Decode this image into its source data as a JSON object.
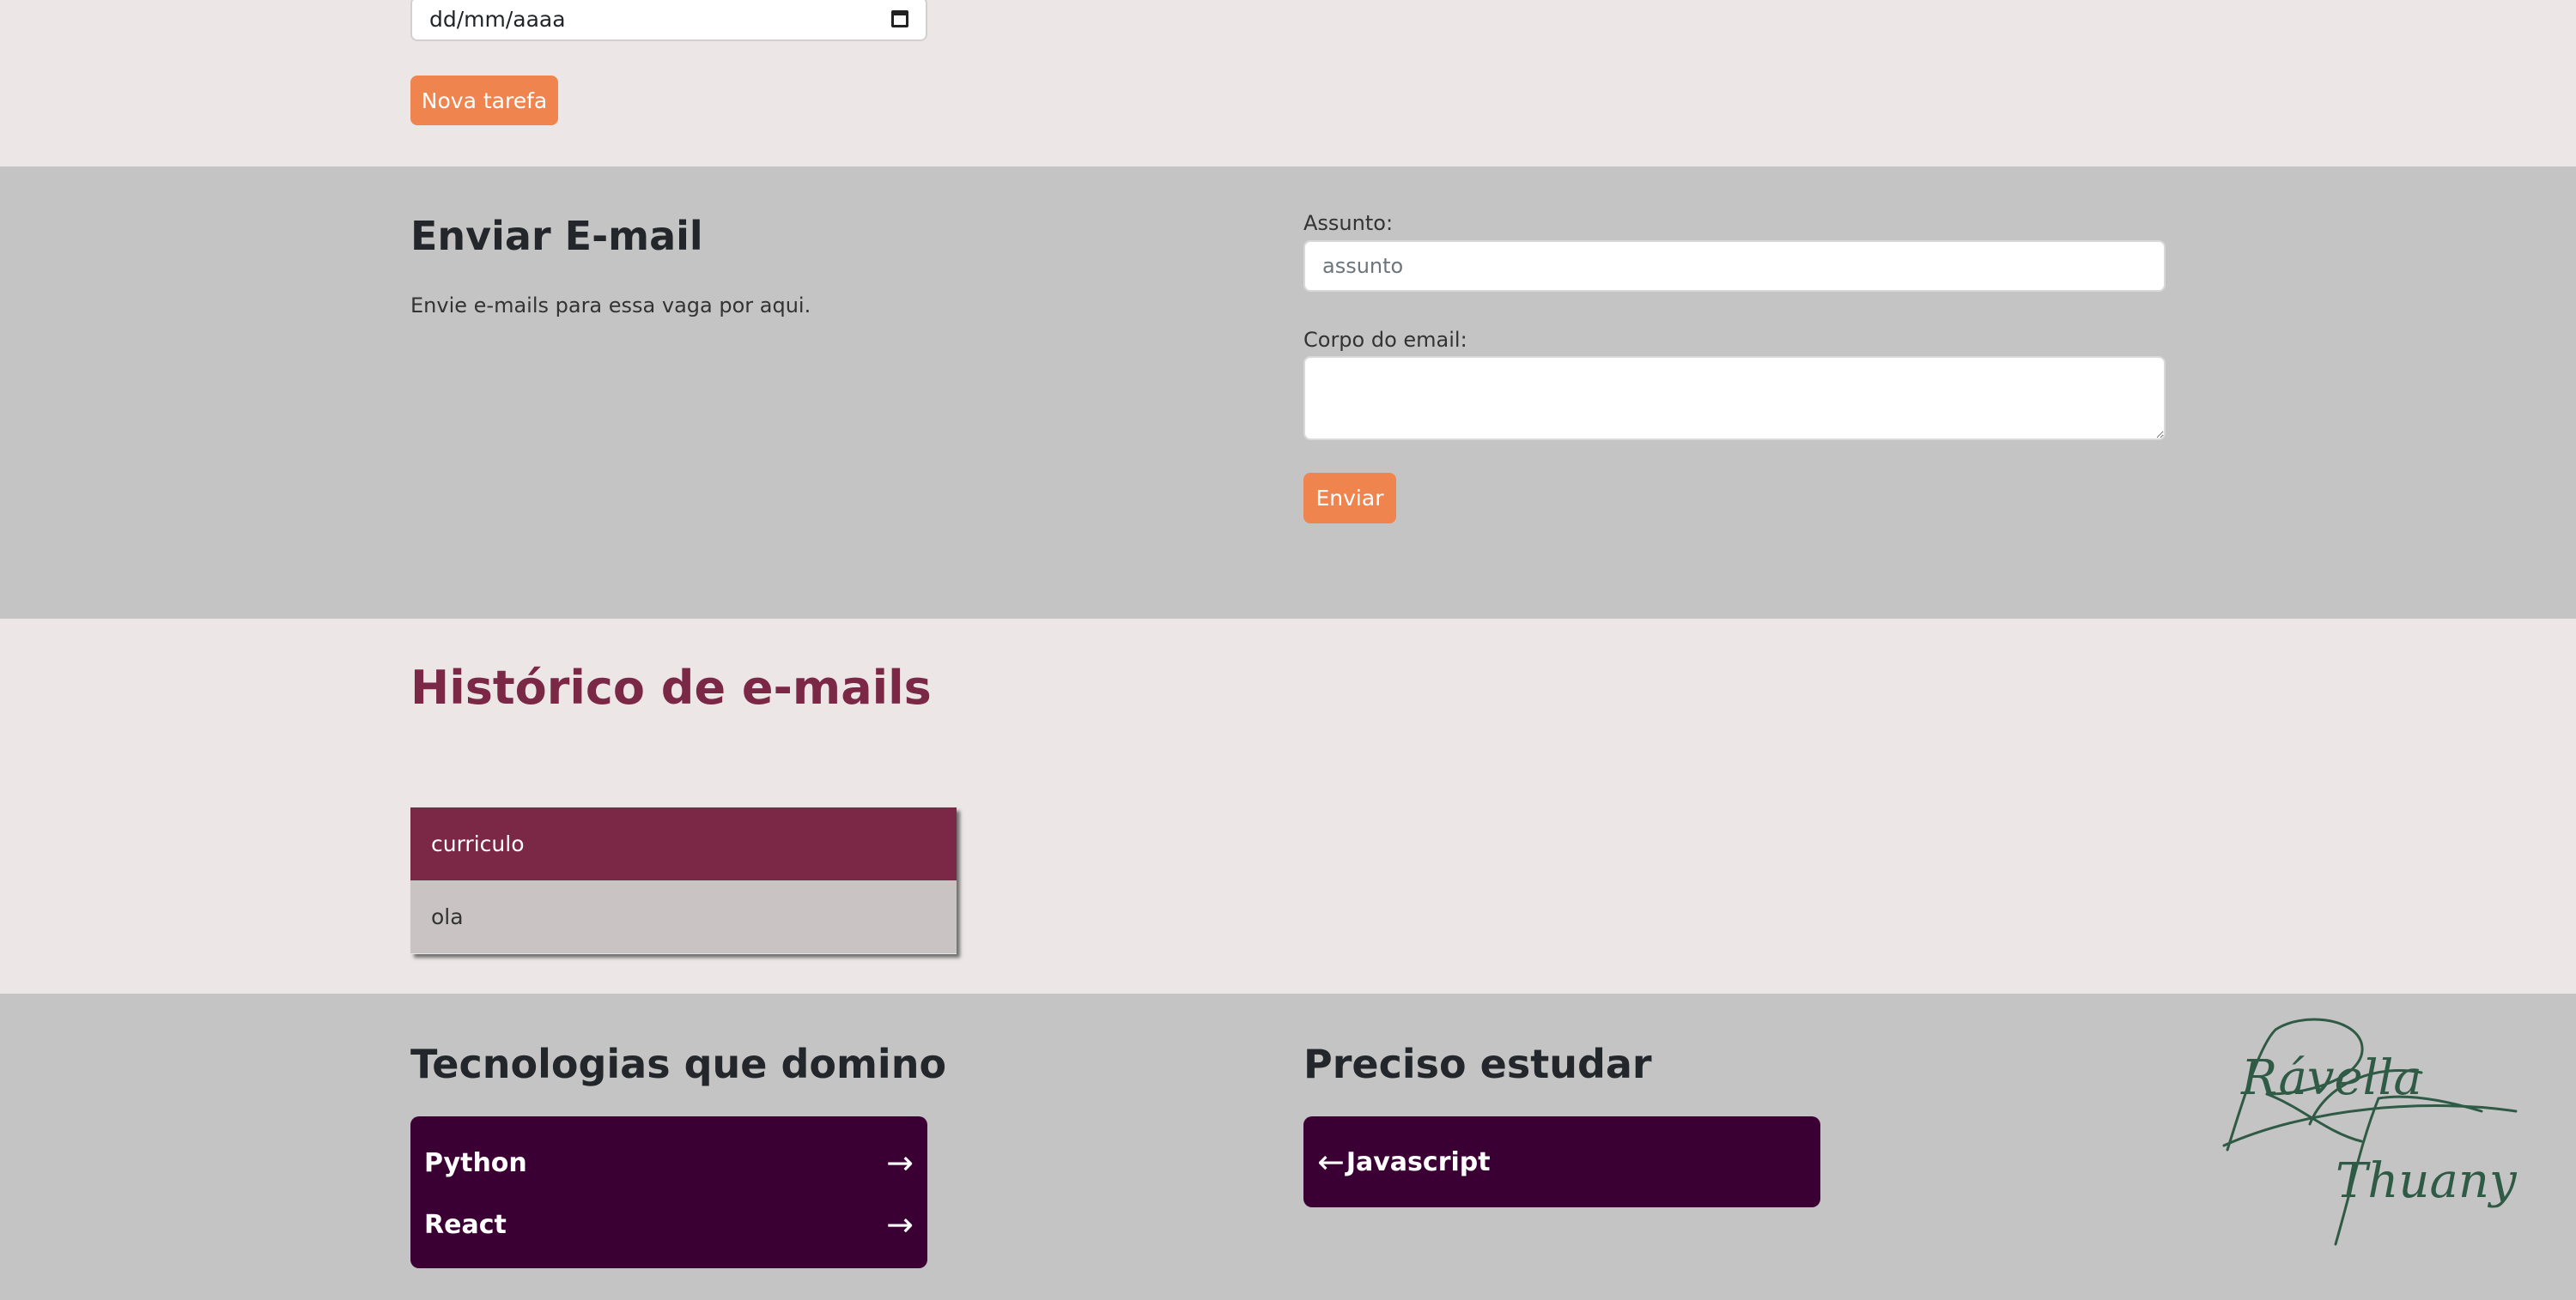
{
  "task_form": {
    "date_placeholder": "dd/mm/aaaa",
    "new_task_button": "Nova tarefa"
  },
  "email_section": {
    "title": "Enviar E-mail",
    "description": "Envie e-mails para essa vaga por aqui.",
    "subject_label": "Assunto:",
    "subject_placeholder": "assunto",
    "body_label": "Corpo do email:",
    "send_button": "Enviar"
  },
  "history": {
    "title": "Histórico de e-mails",
    "items": [
      "curriculo",
      "ola"
    ]
  },
  "technologies": {
    "title": "Tecnologias que domino",
    "items": [
      "Python",
      "React"
    ]
  },
  "study": {
    "title": "Preciso estudar",
    "items": [
      "Javascript"
    ]
  },
  "signature": {
    "line1": "Rávella",
    "line2": "Thuany"
  },
  "colors": {
    "accent_orange": "#f0844f",
    "wine": "#7b2746",
    "dark_purple": "#3b0033",
    "light_bg": "#ede6e6",
    "gray_bg": "#c4c4c4"
  }
}
